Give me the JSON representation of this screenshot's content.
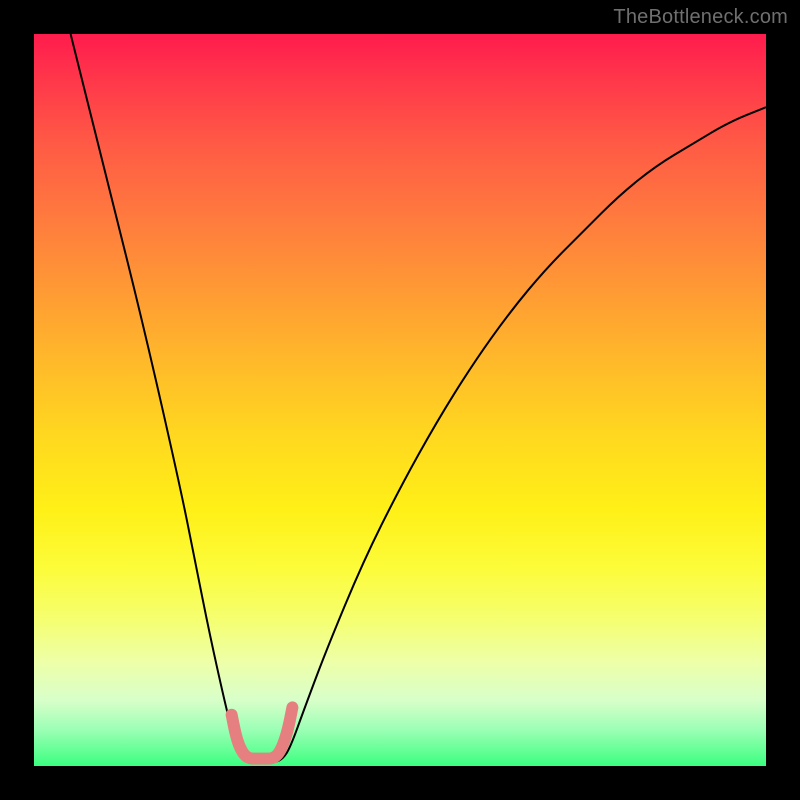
{
  "watermark": {
    "text": "TheBottleneck.com"
  },
  "chart_data": {
    "type": "line",
    "title": "",
    "xlabel": "",
    "ylabel": "",
    "xlim": [
      0,
      100
    ],
    "ylim": [
      0,
      100
    ],
    "grid": false,
    "legend": false,
    "series": [
      {
        "name": "bottleneck-curve",
        "color": "#000000",
        "line_width": 2,
        "x": [
          5,
          10,
          15,
          20,
          22,
          24,
          26,
          27,
          28,
          29,
          30,
          31,
          32,
          33,
          34,
          35,
          37,
          40,
          45,
          50,
          55,
          60,
          65,
          70,
          75,
          80,
          85,
          90,
          95,
          100
        ],
        "values": [
          100,
          80,
          60,
          38,
          28,
          18,
          9,
          5,
          2.5,
          1,
          0.5,
          0.5,
          0.5,
          0.5,
          1,
          2.5,
          8,
          16,
          28,
          38,
          47,
          55,
          62,
          68,
          73,
          78,
          82,
          85,
          88,
          90
        ]
      },
      {
        "name": "optimal-marker",
        "color": "#e68080",
        "line_width": 12,
        "x": [
          27,
          27.5,
          28,
          28.7,
          29.5,
          30.5,
          31.5,
          32.5,
          33.3,
          34,
          34.7,
          35.3
        ],
        "values": [
          7,
          4.5,
          2.8,
          1.5,
          1,
          1,
          1,
          1,
          1.5,
          2.8,
          5,
          8
        ]
      }
    ],
    "background": {
      "type": "vertical-gradient",
      "stops": [
        {
          "pos": 0,
          "color": "#ff1c4d"
        },
        {
          "pos": 25,
          "color": "#ff7a3e"
        },
        {
          "pos": 55,
          "color": "#ffd81f"
        },
        {
          "pos": 80,
          "color": "#f5ff70"
        },
        {
          "pos": 100,
          "color": "#3bff80"
        }
      ]
    }
  }
}
